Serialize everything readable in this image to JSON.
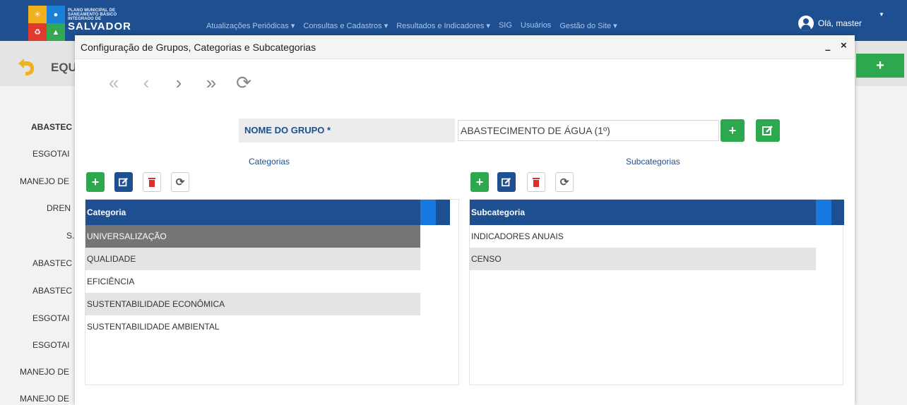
{
  "navbar": {
    "logo_line1": "PLANO MUNICIPAL DE",
    "logo_line2": "SANEAMENTO BÁSICO",
    "logo_line3": "INTEGRADO DE",
    "logo_line4": "SALVADOR",
    "menu": [
      "Atualizações Periódicas ▾",
      "Consultas e Cadastros ▾",
      "Resultados e Indicadores ▾",
      "SIG",
      "Usuários",
      "Gestão do Site ▾"
    ],
    "user_greeting": "Olá, master",
    "colors": {
      "navbar": "#1e4f91",
      "accent_green": "#2ea84f",
      "accent_blue": "#1878e0"
    }
  },
  "background": {
    "title": "EQU",
    "add_button": "+",
    "list_items": [
      "ABASTEC",
      "ESGOTAI",
      "MANEJO DE",
      "DREN",
      "S.",
      "ABASTEC",
      "ABASTEC",
      "ESGOTAI",
      "ESGOTAI",
      "MANEJO DE",
      "MANEJO DE"
    ]
  },
  "modal": {
    "title": "Configuração de Grupos, Categorias e Subcategorias",
    "minimize": "–",
    "close": "×",
    "pager": {
      "first": "«",
      "prev": "‹",
      "next": "›",
      "last": "»",
      "refresh": "⟳"
    },
    "group_label": "NOME DO GRUPO *",
    "group_value": "ABASTECIMENTO DE ÁGUA (1º)",
    "group_add": "+",
    "group_edit": "✎",
    "categorias": {
      "title": "Categorias",
      "toolbar": {
        "add": "+",
        "edit": "✎",
        "delete": "🗑",
        "refresh": "⟳"
      },
      "column": "Categoria",
      "rows": [
        "UNIVERSALIZAÇÃO",
        "QUALIDADE",
        "EFICIÊNCIA",
        "SUSTENTABILIDADE ECONÔMICA",
        "SUSTENTABILIDADE AMBIENTAL"
      ]
    },
    "subcategorias": {
      "title": "Subcategorias",
      "toolbar": {
        "add": "+",
        "edit": "✎",
        "delete": "🗑",
        "refresh": "⟳"
      },
      "column": "Subcategoria",
      "rows": [
        "INDICADORES ANUAIS",
        "CENSO"
      ]
    }
  }
}
